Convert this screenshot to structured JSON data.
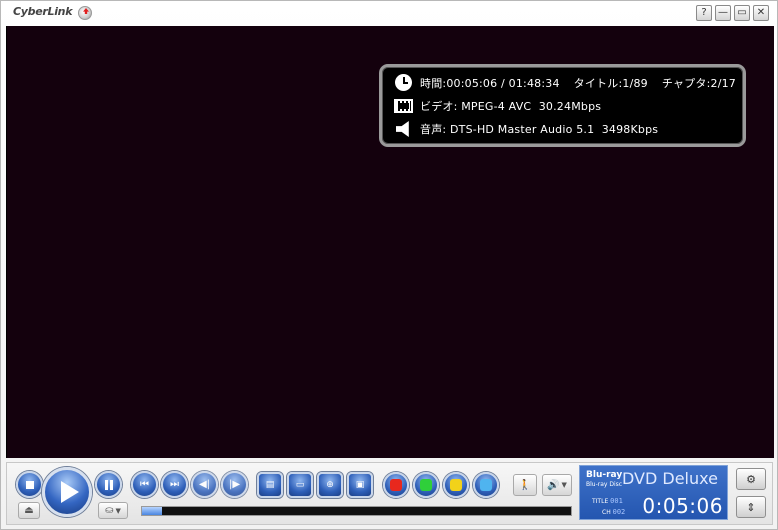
{
  "app": {
    "logo_text": "CyberLink"
  },
  "titlebar": {
    "buttons": {
      "help": "?",
      "minimize": "—",
      "restore": "▭",
      "close": "✕"
    }
  },
  "osd": {
    "time_label": "時間:",
    "time_current": "00:05:06",
    "time_sep": " / ",
    "time_total": "01:48:34",
    "title_label": "タイトル:",
    "title_value": "1/89",
    "chapter_label": "チャプタ:",
    "chapter_value": "2/17",
    "video_label": "ビデオ:",
    "video_value": "MPEG-4 AVC  30.24Mbps",
    "audio_label": "音声:",
    "audio_value": "DTS-HD Master Audio 5.1  3498Kbps"
  },
  "playback": {
    "progress_fraction": 0.047,
    "glyphs": {
      "prev": "⏮",
      "next": "⏭",
      "rewind": "◀|",
      "forward": "|▶",
      "menu": "▤",
      "subtitle": "▭",
      "angle": "⊕",
      "info": "▣",
      "eject": "⏏",
      "disc": "⛀",
      "walk": "🚶",
      "volume": "🔊",
      "config": "⚙",
      "expand": "⇕"
    },
    "color_buttons": [
      {
        "color": "#e8281e"
      },
      {
        "color": "#2fcf3a"
      },
      {
        "color": "#f2d21a"
      },
      {
        "color": "#4fb4ef"
      }
    ]
  },
  "lcd": {
    "brand_top": "Blu-ray",
    "brand_bottom": "Blu-ray Disc",
    "product": "DVD Deluxe",
    "title_label": "TITLE",
    "title_num": "001",
    "chapter_label": "CH",
    "chapter_num": "002",
    "time": "0:05:06"
  },
  "colors": {
    "accent": "#2e5fb8",
    "video_bg": "#14010d"
  }
}
